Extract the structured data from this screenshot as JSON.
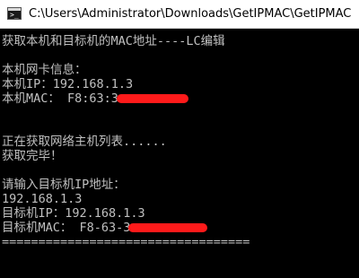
{
  "window": {
    "title": "C:\\Users\\Administrator\\Downloads\\GetIPMAC\\GetIPMAC"
  },
  "console": {
    "lines": [
      "获取本机和目标机的MAC地址----LC编辑",
      "",
      "本机网卡信息：",
      "本机IP：192.168.1.3",
      "本机MAC： F8:63:3",
      "",
      "",
      "正在获取网络主机列表......",
      "获取完毕！",
      "",
      "请输入目标机IP地址：",
      "192.168.1.3",
      "目标机IP：192.168.1.3",
      "目标机MAC： F8-63-3",
      "=================================="
    ]
  },
  "colors": {
    "console_bg": "#000000",
    "console_fg": "#c0c0c0",
    "redaction": "#ff1a1a",
    "titlebar_bg": "#ffffff"
  },
  "icons": {
    "app": "terminal-icon"
  }
}
